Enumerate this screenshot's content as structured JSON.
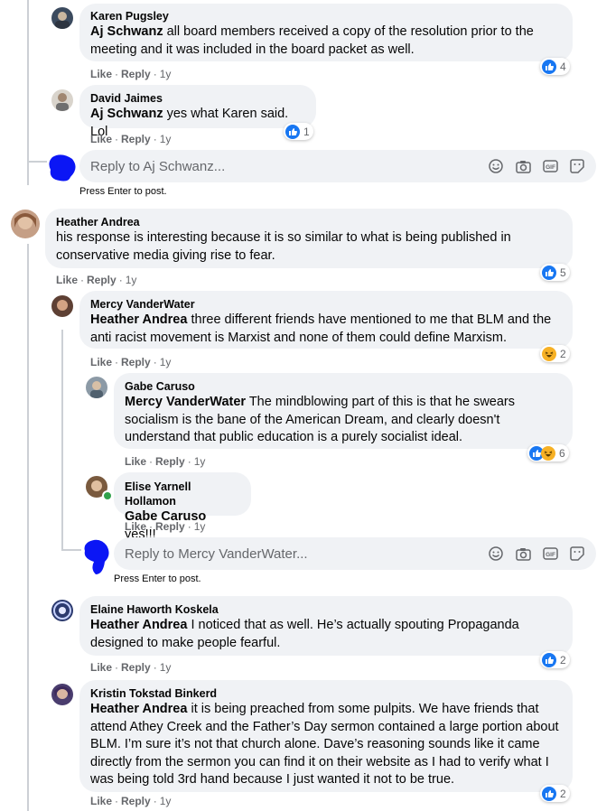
{
  "actions": {
    "like": "Like",
    "reply": "Reply"
  },
  "comments": [
    {
      "author": "Karen Pugsley",
      "mention": "Aj Schwanz",
      "text": " all board members received a copy of the resolution prior to the meeting and it was included in the board packet as well.",
      "age": "1y",
      "reactions": "4"
    },
    {
      "author": "David Jaimes",
      "mention": "Aj Schwanz",
      "text": " yes what Karen said. Lol",
      "age": "1y",
      "reactions": "1"
    },
    {
      "author": "Heather Andrea",
      "mention": "",
      "text": "his response is interesting because it is so similar to what is being published in conservative media giving rise to fear.",
      "age": "1y",
      "reactions": "5"
    },
    {
      "author": "Mercy VanderWater",
      "mention": "Heather Andrea",
      "text": " three different friends have mentioned to me that BLM and the anti racist movement is Marxist and none of them could define Marxism.",
      "age": "1y",
      "reactions": "2"
    },
    {
      "author": "Gabe Caruso",
      "mention": "Mercy VanderWater",
      "text": " The mindblowing part of this is that he swears socialism is the bane of the American Dream, and clearly doesn't understand that public education is a purely socialist ideal.",
      "age": "1y",
      "reactions": "6"
    },
    {
      "author": "Elise Yarnell Hollamon",
      "mention": "Gabe Caruso",
      "text": " yes!!!",
      "age": "1y",
      "reactions": ""
    },
    {
      "author": "Elaine Haworth Koskela",
      "mention": "Heather Andrea",
      "text": " I noticed that as well. He’s actually spouting Propaganda designed to make people fearful.",
      "age": "1y",
      "reactions": "2"
    },
    {
      "author": "Kristin Tokstad Binkerd",
      "mention": "Heather Andrea",
      "text": " it is being preached from some pulpits. We have friends that attend Athey Creek and the Father’s Day sermon contained a large portion about BLM. I’m sure it’s not that church alone. Dave’s reasoning sounds like it came directly from the sermon you can find it on their website as I had to verify what I was being told 3rd hand because I just wanted it not to be true.",
      "age": "1y",
      "reactions": "2"
    }
  ],
  "reply_boxes": [
    {
      "placeholder": "Reply to Aj Schwanz...",
      "hint": "Press Enter to post."
    },
    {
      "placeholder": "Reply to Mercy VanderWater...",
      "hint": "Press Enter to post."
    }
  ],
  "icons": [
    "emoji-icon",
    "camera-icon",
    "gif-icon",
    "sticker-icon",
    "like-reaction-icon",
    "haha-reaction-icon"
  ],
  "colors": {
    "bubble": "#f0f2f5",
    "like_blue": "#1877f2",
    "secondary_text": "#65676b",
    "redaction": "#0b16f5"
  }
}
